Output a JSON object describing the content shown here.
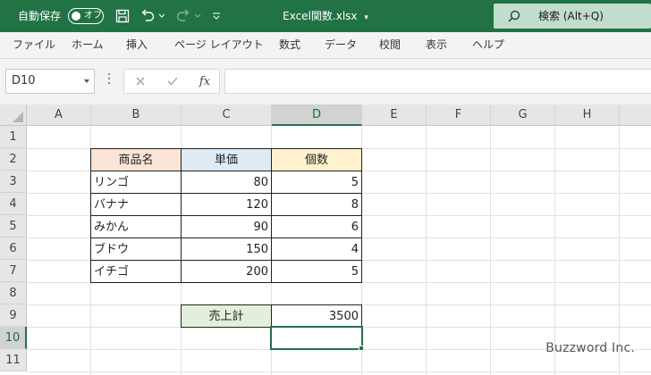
{
  "titlebar": {
    "autosave_label": "自動保存",
    "autosave_state": "オフ",
    "filename": "Excel関数.xlsx",
    "search_label": "検索 (Alt+Q)",
    "brand_color": "#217346"
  },
  "menu": [
    "ファイル",
    "ホーム",
    "挿入",
    "ページ レイアウト",
    "数式",
    "データ",
    "校閲",
    "表示",
    "ヘルプ"
  ],
  "formula_bar": {
    "name_box": "D10",
    "fx": "fx",
    "content": ""
  },
  "grid": {
    "columns": [
      "A",
      "B",
      "C",
      "D",
      "E",
      "F",
      "G",
      "H"
    ],
    "rows": [
      "1",
      "2",
      "3",
      "4",
      "5",
      "6",
      "7",
      "8",
      "9",
      "10",
      "11"
    ],
    "selected_column": "D",
    "selected_row": "10",
    "table": {
      "headers": [
        "商品名",
        "単価",
        "個数"
      ],
      "header_colors": [
        "#fbe5d6",
        "#ddebf7",
        "#fff2cc"
      ],
      "rows": [
        [
          "リンゴ",
          "80",
          "5"
        ],
        [
          "バナナ",
          "120",
          "8"
        ],
        [
          "みかん",
          "90",
          "6"
        ],
        [
          "ブドウ",
          "150",
          "4"
        ],
        [
          "イチゴ",
          "200",
          "5"
        ]
      ]
    },
    "total": {
      "label": "売上計",
      "value": "3500",
      "label_color": "#e2efda"
    }
  },
  "watermark": "Buzzword Inc."
}
